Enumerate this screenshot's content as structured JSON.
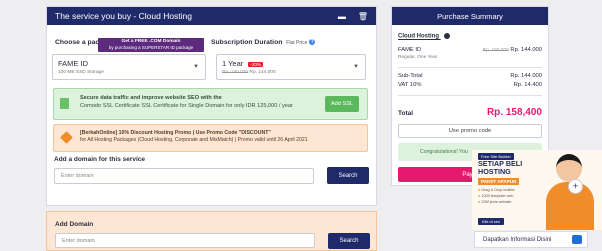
{
  "main_card": {
    "title": "The service you buy - Cloud Hosting",
    "tool_minimize": "▬",
    "tool_delete": "🗑"
  },
  "package": {
    "label": "Choose a package",
    "popup_title": "Get a FREE .COM Domain",
    "popup_sub": "by purchasing a SUPERSTAR ID package",
    "selected_name": "FAME ID",
    "selected_spec": "100 MB SSD Storage"
  },
  "duration": {
    "label": "Subscription Duration",
    "label_note": "Flat Price",
    "selected": "1 Year",
    "discount_badge": "-20%",
    "old_price": "Rp. 180.000",
    "new_price": "Rp. 144.000"
  },
  "ssl": {
    "line1": "Secure data traffic and improve website SEO with the",
    "line2": "Comodo SSL Certificate SSL Certificate for Single Domain for only IDR 125,000 / year",
    "button": "Add SSL"
  },
  "discount": {
    "line1": "[BerkahOnline] 10% Discount Hosting Promo | Use Promo Code \"DISCOUNT\"",
    "line2": "for All Hosting Packages (Cloud Hosting, Corporate and MixMatch) | Promo valid until 26 April 2021"
  },
  "domain": {
    "label": "Add a domain for this service",
    "placeholder": "Enter domain",
    "search": "Search"
  },
  "add_domain": {
    "title": "Add Domain",
    "placeholder": "Enter domain",
    "search": "Search"
  },
  "summary": {
    "title": "Purchase Summary",
    "product": "Cloud Hosting",
    "item_name": "FAME ID",
    "item_sub": "Regular, One Year",
    "item_old_price": "Rp. 180.000",
    "item_price": "Rp. 144.000",
    "subtotal_label": "Sub-Total",
    "subtotal_value": "Rp. 144.000",
    "vat_label": "VAT 10%",
    "vat_value": "Rp. 14.400",
    "total_label": "Total",
    "total_value": "Rp. 158,400",
    "promo_button": "Use promo code",
    "congrats": "Congratulations! You",
    "pay_button": "Pay n"
  },
  "ad": {
    "tag": "Free Site Builder",
    "title_line1": "SETIAP BELI",
    "title_line2": "HOSTING",
    "ribbon": "PAKET APAPUN",
    "feat1": "Drag & Drop builder",
    "feat2": "1000 template web",
    "feat3": "20M jenis website",
    "cta": "Klik di sini"
  },
  "chat": {
    "label": "Dapatkan Informasi Disini"
  },
  "colors": {
    "navy": "#1f2a6b",
    "pink": "#e6196f",
    "green": "#5cb85c",
    "orange": "#f08c2a"
  }
}
